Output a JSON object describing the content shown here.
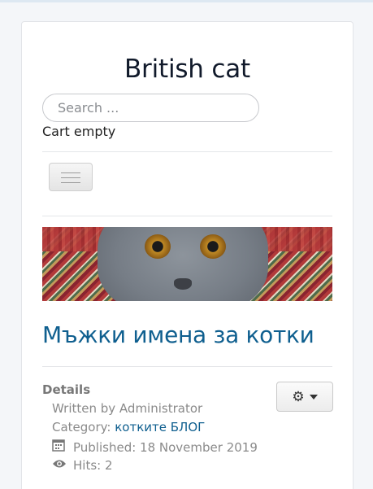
{
  "site": {
    "title": "British cat"
  },
  "search": {
    "placeholder": "Search ..."
  },
  "cart": {
    "status": "Cart empty"
  },
  "banner": {
    "alt": "British cat close-up photo on patterned rug"
  },
  "article": {
    "title": "Мъжки имена за котки",
    "details_label": "Details",
    "written_by": "Written by Administrator",
    "category_label": "Category: ",
    "category_link": "котките БЛОГ",
    "published": "Published: 18 November 2019",
    "hits": "Hits: 2"
  },
  "icons": {
    "nav_toggle": "hamburger-icon",
    "tools": "gear-icon",
    "published": "calendar-icon",
    "hits": "eye-icon"
  },
  "colors": {
    "link": "#0f5f8f",
    "title": "#111a2b"
  }
}
